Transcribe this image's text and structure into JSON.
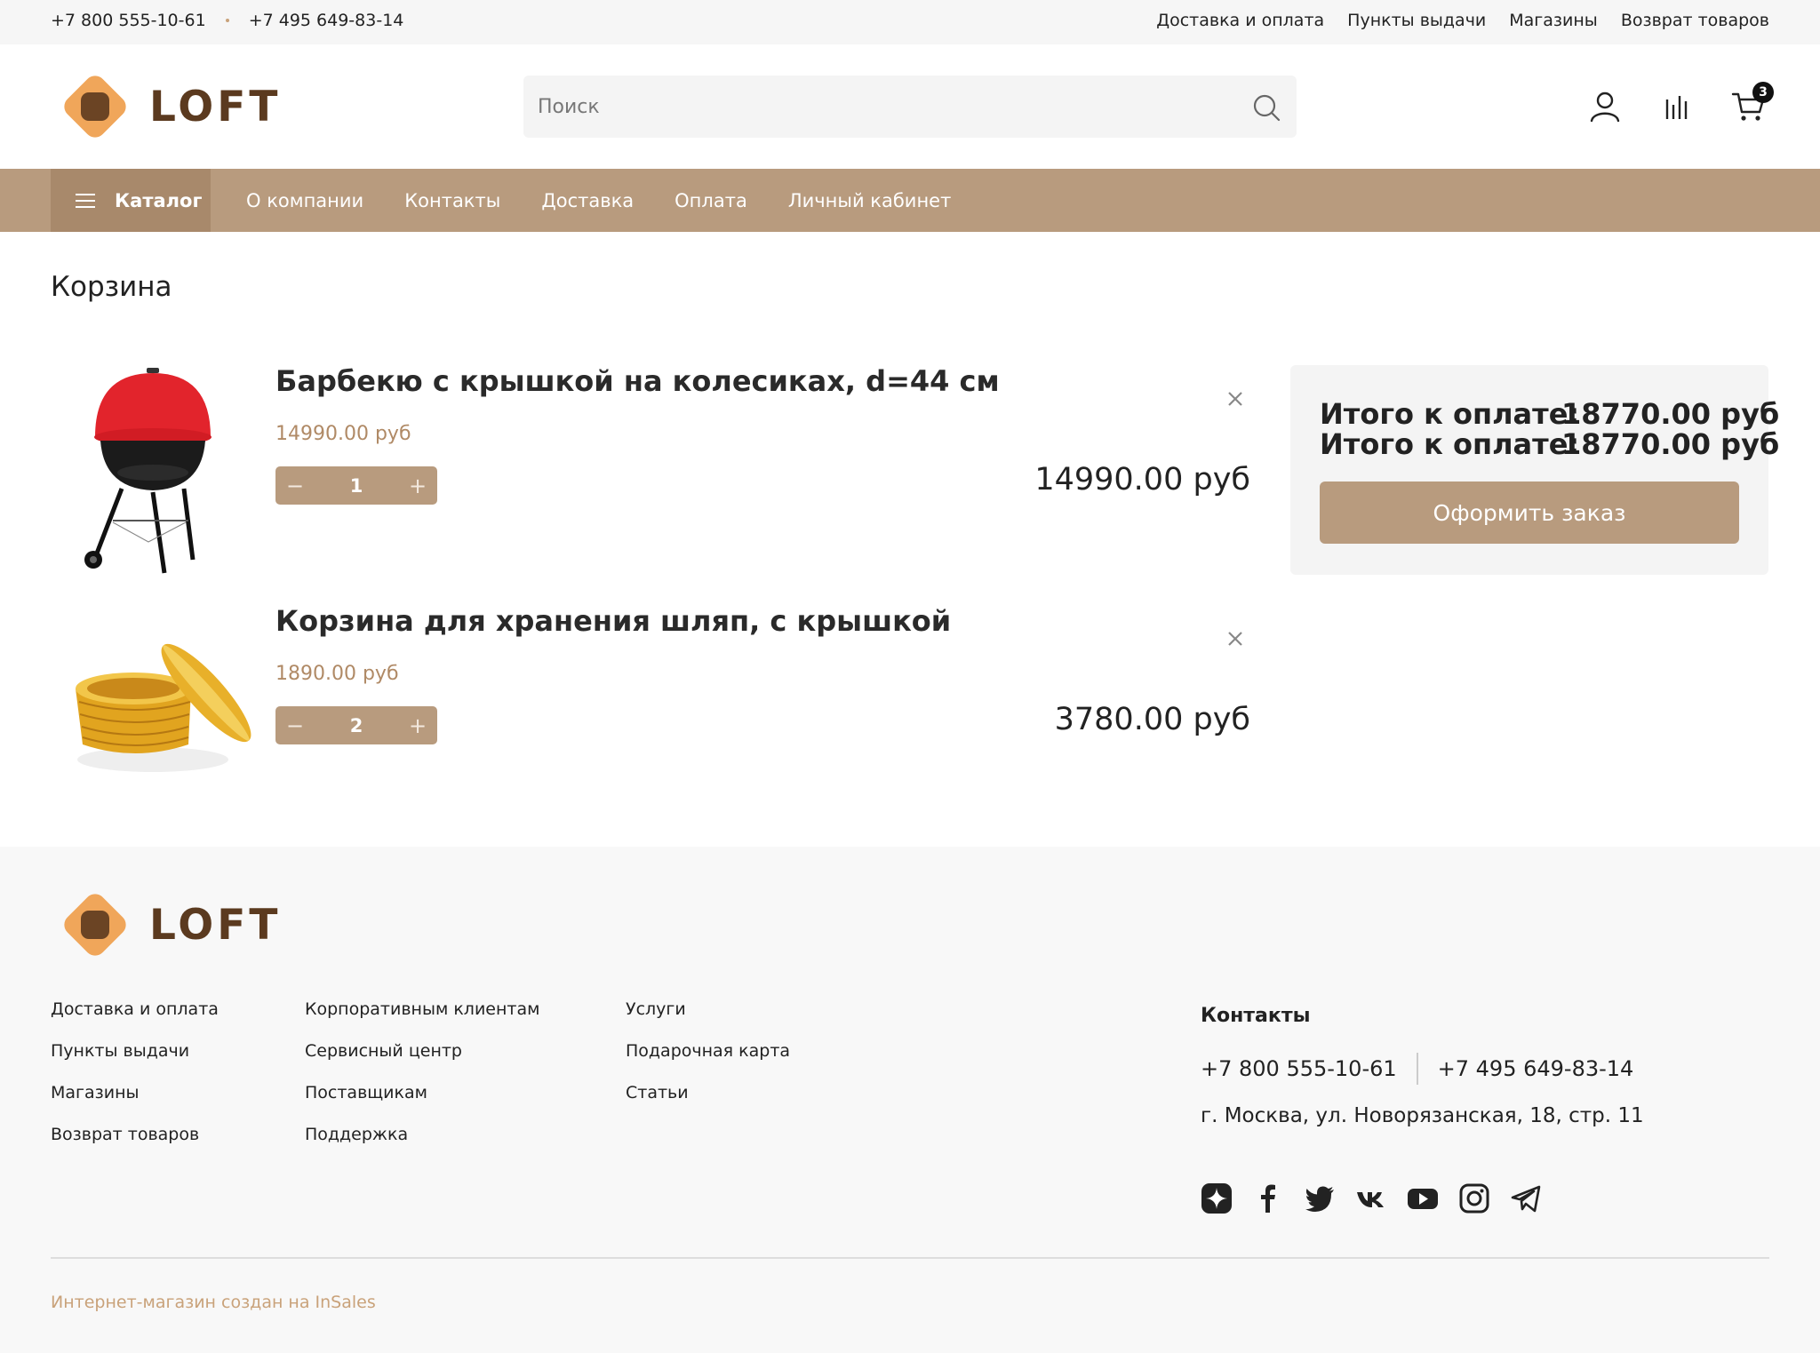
{
  "topbar": {
    "phone1": "+7 800 555-10-61",
    "phone2": "+7 495 649-83-14",
    "links": [
      "Доставка и оплата",
      "Пункты выдачи",
      "Магазины",
      "Возврат товаров"
    ]
  },
  "brand": {
    "name": "LOFT",
    "accent": "#f0a65a",
    "dark": "#6b4424"
  },
  "search": {
    "placeholder": "Поиск",
    "value": ""
  },
  "header_icons": {
    "cart_count": "3"
  },
  "nav": {
    "catalog_label": "Каталог",
    "items": [
      "О компании",
      "Контакты",
      "Доставка",
      "Оплата",
      "Личный кабинет"
    ],
    "color": "#b89b7e"
  },
  "page": {
    "title": "Корзина"
  },
  "cart": {
    "items": [
      {
        "name": "Барбекю с крышкой на колесиках, d=44 см",
        "unit_price": "14990.00 руб",
        "quantity": "1",
        "total": "14990.00 руб"
      },
      {
        "name": "Корзина для хранения шляп, с крышкой",
        "unit_price": "1890.00 руб",
        "quantity": "2",
        "total": "3780.00 руб"
      }
    ],
    "stepper": {
      "minus": "−",
      "plus": "+"
    }
  },
  "summary": {
    "label": "Итого к оплате:",
    "value": "18770.00 руб",
    "checkout_label": "Оформить заказ"
  },
  "footer": {
    "col1": [
      "Доставка и оплата",
      "Пункты выдачи",
      "Магазины",
      "Возврат товаров"
    ],
    "col2": [
      "Корпоративным клиентам",
      "Сервисный центр",
      "Поставщикам",
      "Поддержка"
    ],
    "col3": [
      "Услуги",
      "Подарочная карта",
      "Статьи"
    ],
    "contacts_title": "Контакты",
    "phone1": "+7 800 555-10-61",
    "phone2": "+7 495 649-83-14",
    "address": "г. Москва, ул. Новорязанская, 18, стр. 11",
    "socials": [
      "zen-icon",
      "facebook-icon",
      "twitter-icon",
      "vk-icon",
      "youtube-icon",
      "instagram-icon",
      "telegram-icon"
    ],
    "credit": "Интернет-магазин создан на InSales"
  }
}
